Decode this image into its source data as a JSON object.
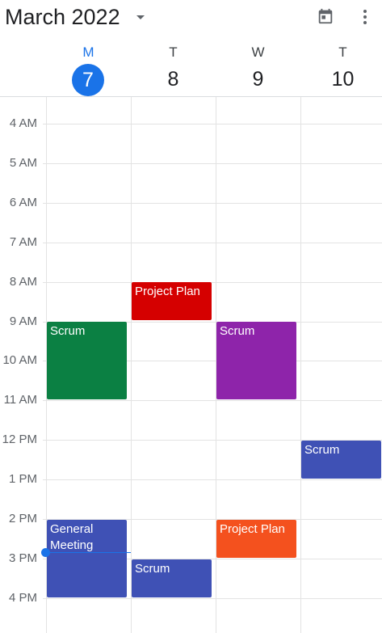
{
  "header": {
    "month_title": "March 2022",
    "icons": {
      "calendar": "calendar-today-icon",
      "more": "more-vert-icon"
    }
  },
  "days": [
    {
      "letter": "M",
      "number": "7",
      "today": true
    },
    {
      "letter": "T",
      "number": "8",
      "today": false
    },
    {
      "letter": "W",
      "number": "9",
      "today": false
    },
    {
      "letter": "T",
      "number": "10",
      "today": false
    }
  ],
  "hours": [
    "4 AM",
    "5 AM",
    "6 AM",
    "7 AM",
    "8 AM",
    "9 AM",
    "10 AM",
    "11 AM",
    "12 PM",
    "1 PM",
    "2 PM",
    "3 PM",
    "4 PM"
  ],
  "events": [
    {
      "title": "Project Plan",
      "day": "T 8",
      "start": "8 AM",
      "end": "9 AM",
      "color": "#d50000"
    },
    {
      "title": "Scrum",
      "day": "M 7",
      "start": "9 AM",
      "end": "11 AM",
      "color": "#0b8043"
    },
    {
      "title": "Scrum",
      "day": "W 9",
      "start": "9 AM",
      "end": "11 AM",
      "color": "#8e24aa"
    },
    {
      "title": "Scrum",
      "day": "T 10",
      "start": "12 PM",
      "end": "1 PM",
      "color": "#3f51b5"
    },
    {
      "title": "General Meeting",
      "day": "M 7",
      "start": "2 PM",
      "end": "4 PM",
      "color": "#3f51b5"
    },
    {
      "title": "Project Plan",
      "day": "W 9",
      "start": "2 PM",
      "end": "3 PM",
      "color": "#f4511e"
    },
    {
      "title": "Scrum",
      "day": "T 8",
      "start": "3 PM",
      "end": "4 PM",
      "color": "#3f51b5"
    }
  ],
  "colors": {
    "accent": "#1a73e8"
  }
}
